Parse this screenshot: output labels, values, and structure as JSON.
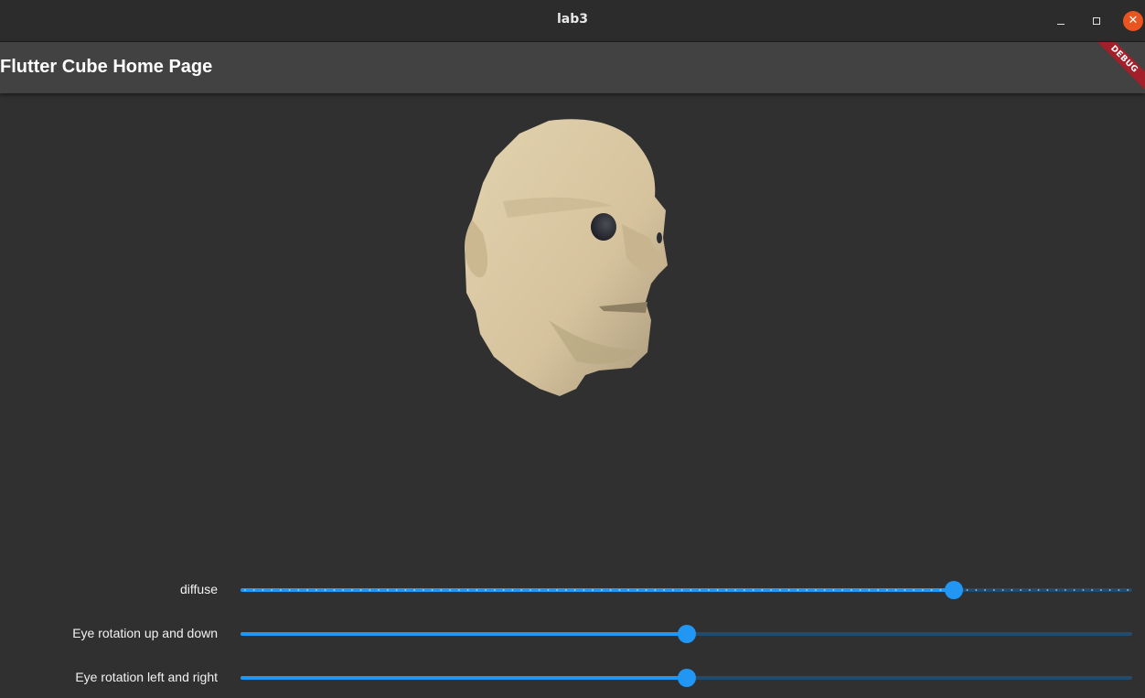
{
  "window": {
    "title": "lab3",
    "controls": {
      "minimize": "minimize",
      "maximize": "maximize",
      "close": "✕"
    }
  },
  "appbar": {
    "title": "Flutter Cube Home Page",
    "debug_banner": "DEBUG"
  },
  "scene": {
    "model": "head"
  },
  "sliders": [
    {
      "label": "diffuse",
      "value": 0.8,
      "divisions": true
    },
    {
      "label": "Eye rotation up and down",
      "value": 0.5,
      "divisions": false
    },
    {
      "label": "Eye rotation left and right",
      "value": 0.5,
      "divisions": false
    }
  ],
  "colors": {
    "accent": "#2196f3",
    "inactive_track": "#244a6c",
    "background": "#303030",
    "appbar": "#424242",
    "close_button": "#e95420",
    "skin": "#d8c7a2",
    "debug_banner": "#a3202a"
  }
}
